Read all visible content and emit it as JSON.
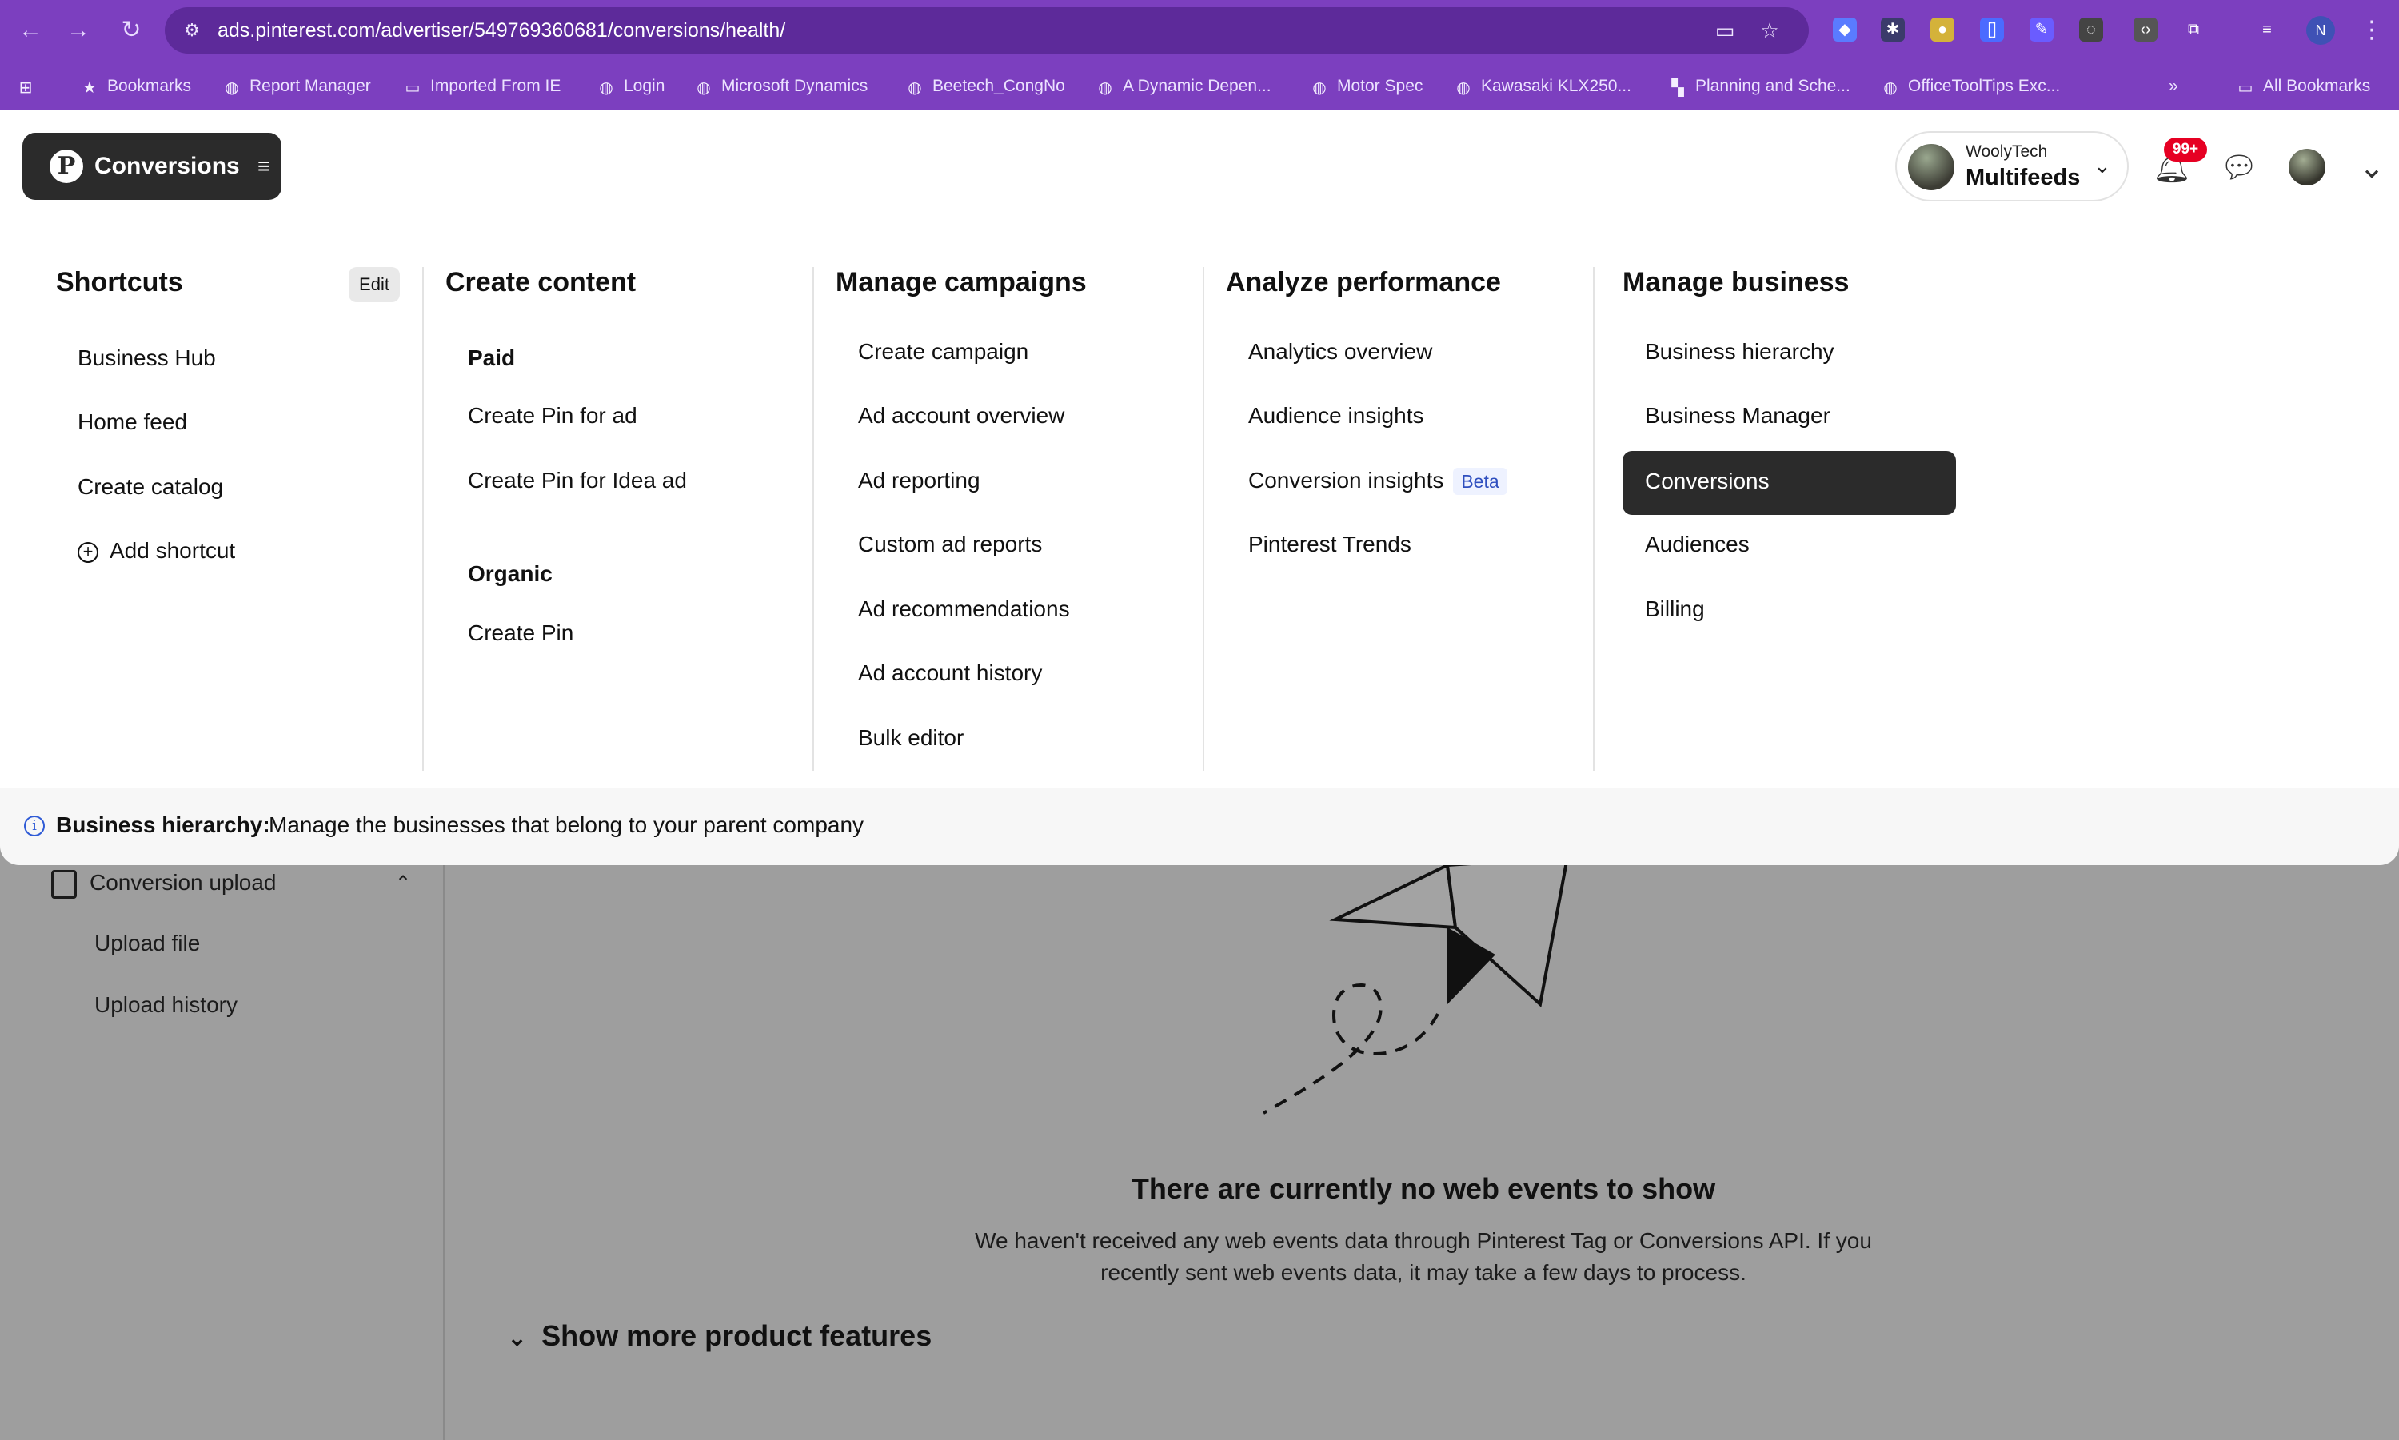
{
  "browser": {
    "url": "ads.pinterest.com/advertiser/549769360681/conversions/health/",
    "bookmarks": [
      "Bookmarks",
      "Report Manager",
      "Imported From IE",
      "Login",
      "Microsoft Dynamics",
      "Beetech_CongNo",
      "A Dynamic Depen...",
      "Motor Spec",
      "Kawasaki KLX250...",
      "Planning and Sche...",
      "OfficeToolTips Exc..."
    ],
    "all_bookmarks": "All Bookmarks",
    "profile_initial": "N"
  },
  "header": {
    "product_button": "Conversions",
    "account_small": "WoolyTech",
    "account_name": "Multifeeds",
    "notifications_badge": "99+"
  },
  "menu": {
    "shortcuts": {
      "title": "Shortcuts",
      "edit": "Edit",
      "items": [
        "Business Hub",
        "Home feed",
        "Create catalog"
      ],
      "add": "Add shortcut"
    },
    "create_content": {
      "title": "Create content",
      "paid_label": "Paid",
      "paid_items": [
        "Create Pin for ad",
        "Create Pin for Idea ad"
      ],
      "organic_label": "Organic",
      "organic_items": [
        "Create Pin"
      ]
    },
    "manage_campaigns": {
      "title": "Manage campaigns",
      "items": [
        "Create campaign",
        "Ad account overview",
        "Ad reporting",
        "Custom ad reports",
        "Ad recommendations",
        "Ad account history",
        "Bulk editor"
      ]
    },
    "analyze_performance": {
      "title": "Analyze performance",
      "items": [
        "Analytics overview",
        "Audience insights",
        "Conversion insights",
        "Pinterest Trends"
      ],
      "beta": "Beta"
    },
    "manage_business": {
      "title": "Manage business",
      "items": [
        "Business hierarchy",
        "Business Manager",
        "Conversions",
        "Audiences",
        "Billing"
      ],
      "active": "Conversions"
    }
  },
  "info": {
    "label": "Business hierarchy:",
    "text": "Manage the businesses that belong to your parent company"
  },
  "background": {
    "sidebar": {
      "section": "Conversion upload",
      "items": [
        "Upload file",
        "Upload history"
      ]
    },
    "empty_state": {
      "title": "There are currently no web events to show",
      "body": "We haven't received any web events data through Pinterest Tag or Conversions API. If you recently sent web events data, it may take a few days to process."
    },
    "show_more": "Show more product features"
  },
  "colors": {
    "chrome": "#7c3fbf",
    "primary_dark": "#2b2b2b",
    "badge_red": "#e60023",
    "overlay_gray": "#9e9e9e"
  }
}
